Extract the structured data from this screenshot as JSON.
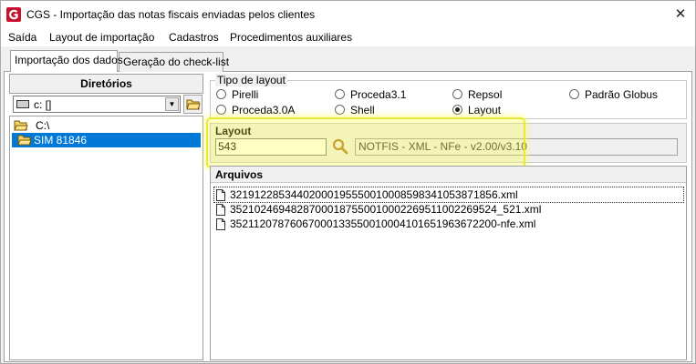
{
  "window": {
    "title": "CGS - Importação das notas fiscais enviadas pelos clientes",
    "close_glyph": "✕",
    "logo_icon": "cgs-logo-icon"
  },
  "menu": [
    "Saída",
    "Layout de importação",
    "Cadastros",
    "Procedimentos auxiliares"
  ],
  "tabs": [
    "Importação dos dados",
    "Geração do check-list"
  ],
  "directories": {
    "header": "Diretórios",
    "drive": "c: []",
    "tree": [
      "C:\\",
      "SIM 81846"
    ],
    "selected_index": 1
  },
  "tipo_layout": {
    "legend": "Tipo de layout",
    "options": [
      "Pirelli",
      "Proceda3.1",
      "Repsol",
      "Padrão Globus",
      "Proceda3.0A",
      "Shell",
      "Layout"
    ],
    "selected": "Layout"
  },
  "layout": {
    "title": "Layout",
    "code": "543",
    "description": "NOTFIS - XML - NFe - v2.00/v3.10"
  },
  "arquivos": {
    "title": "Arquivos",
    "files": [
      "32191228534402000195550010008598341053871856.xml",
      "35210246948287000187550010002269511002269524_521.xml",
      "35211207876067000133550010004101651963672200-nfe.xml"
    ]
  },
  "colors": {
    "selection": "#0078d7",
    "highlight": "#ffff3c",
    "window_bg": "#f0f0f0"
  }
}
